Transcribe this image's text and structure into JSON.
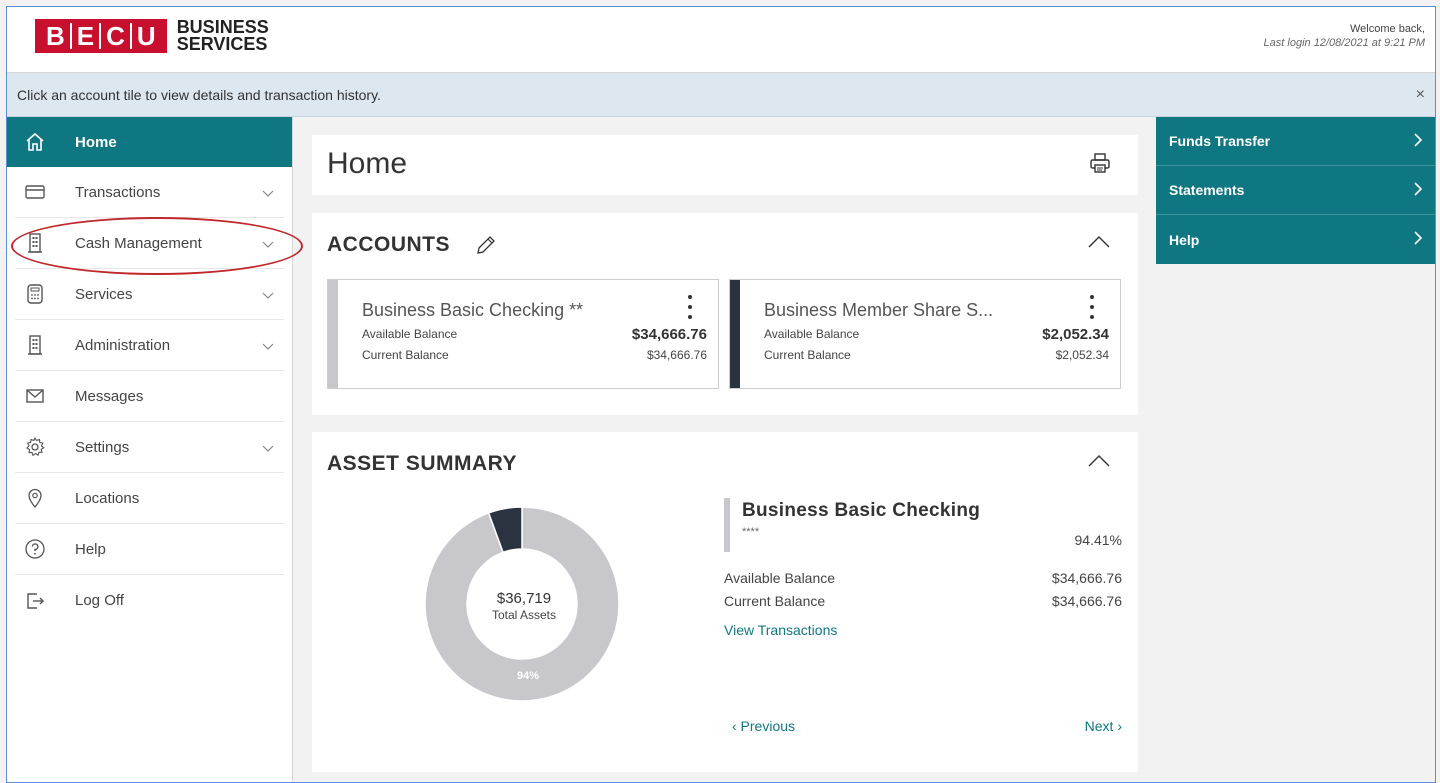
{
  "header": {
    "logo_letters": [
      "B",
      "E",
      "C",
      "U"
    ],
    "logo_line1": "BUSINESS",
    "logo_line2": "SERVICES",
    "welcome": "Welcome back,",
    "last_login": "Last login 12/08/2021 at 9:21 PM"
  },
  "infobar": {
    "message": "Click an account tile to view details and transaction history.",
    "close": "×"
  },
  "sidebar": {
    "items": [
      {
        "label": "Home",
        "icon": "home-icon",
        "active": true
      },
      {
        "label": "Transactions",
        "icon": "card-icon",
        "chevron": true
      },
      {
        "label": "Cash Management",
        "icon": "building-icon",
        "chevron": true
      },
      {
        "label": "Services",
        "icon": "calculator-icon",
        "chevron": true
      },
      {
        "label": "Administration",
        "icon": "building-icon",
        "chevron": true
      },
      {
        "label": "Messages",
        "icon": "envelope-icon"
      },
      {
        "label": "Settings",
        "icon": "gear-icon",
        "chevron": true
      },
      {
        "label": "Locations",
        "icon": "map-pin-icon"
      },
      {
        "label": "Help",
        "icon": "question-icon"
      },
      {
        "label": "Log Off",
        "icon": "logout-icon"
      }
    ]
  },
  "home": {
    "title": "Home"
  },
  "accounts": {
    "title": "ACCOUNTS",
    "tiles": [
      {
        "name": "Business Basic Checking **",
        "available_label": "Available Balance",
        "available": "$34,666.76",
        "current_label": "Current Balance",
        "current": "$34,666.76",
        "color": "#c8c8cc"
      },
      {
        "name": "Business Member Share S...",
        "available_label": "Available Balance",
        "available": "$2,052.34",
        "current_label": "Current Balance",
        "current": "$2,052.34",
        "color": "#2b3340"
      }
    ]
  },
  "asset_summary": {
    "title": "ASSET SUMMARY",
    "total": "$36,719",
    "total_label": "Total Assets",
    "donut_label": "94%",
    "slices": [
      {
        "name": "Business Basic Checking",
        "value": 94.41,
        "color": "#c8c8cc"
      },
      {
        "name": "Business Member Share Savings",
        "value": 5.59,
        "color": "#2b3340"
      }
    ],
    "detail": {
      "name": "Business Basic Checking",
      "mask": "****",
      "percent": "94.41%",
      "available_label": "Available Balance",
      "available": "$34,666.76",
      "current_label": "Current Balance",
      "current": "$34,666.76",
      "link": "View Transactions"
    },
    "prev": "‹  Previous",
    "next": "Next  ›"
  },
  "right_panel": {
    "items": [
      "Funds Transfer",
      "Statements",
      "Help"
    ]
  },
  "colors": {
    "brand_red": "#c8102e",
    "teal": "#0f7782",
    "annotation_red": "#c0282b"
  }
}
